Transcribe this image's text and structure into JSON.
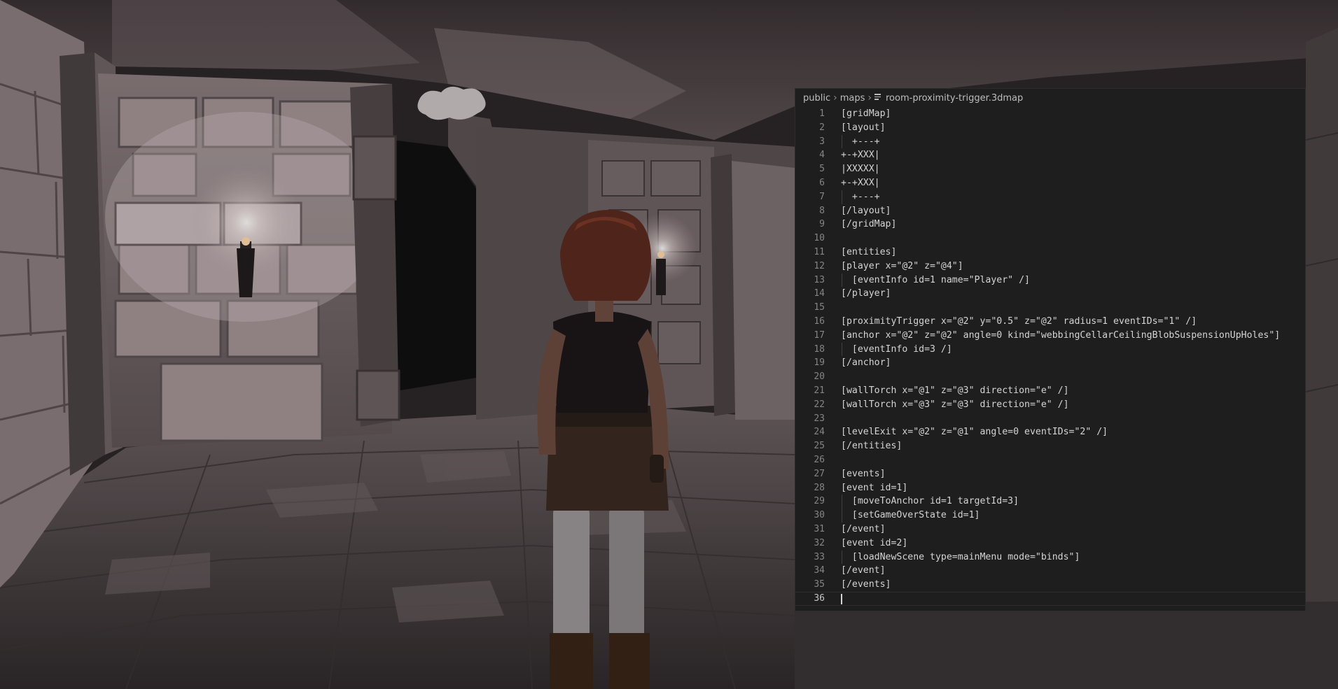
{
  "scene": {
    "description_icons": [
      "wall-torch-icon",
      "player-character"
    ],
    "colors": {
      "torch_glow": "#fff6ee",
      "stone": "#7c6e70",
      "floor": "#4a4244"
    }
  },
  "editor": {
    "breadcrumb": {
      "parts": [
        "public",
        "maps"
      ],
      "file_icon": "file-lines-icon",
      "file_name": "room-proximity-trigger.3dmap"
    },
    "current_line": 36,
    "lines": [
      "[gridMap]",
      "[layout]",
      "  +---+",
      "+-+XXX|",
      "|XXXXX|",
      "+-+XXX|",
      "  +---+",
      "[/layout]",
      "[/gridMap]",
      "",
      "[entities]",
      "[player x=\"@2\" z=\"@4\"]",
      "  [eventInfo id=1 name=\"Player\" /]",
      "[/player]",
      "",
      "[proximityTrigger x=\"@2\" y=\"0.5\" z=\"@2\" radius=1 eventIDs=\"1\" /]",
      "[anchor x=\"@2\" z=\"@2\" angle=0 kind=\"webbingCellarCeilingBlobSuspensionUpHoles\"]",
      "  [eventInfo id=3 /]",
      "[/anchor]",
      "",
      "[wallTorch x=\"@1\" z=\"@3\" direction=\"e\" /]",
      "[wallTorch x=\"@3\" z=\"@3\" direction=\"e\" /]",
      "",
      "[levelExit x=\"@2\" z=\"@1\" angle=0 eventIDs=\"2\" /]",
      "[/entities]",
      "",
      "[events]",
      "[event id=1]",
      "  [moveToAnchor id=1 targetId=3]",
      "  [setGameOverState id=1]",
      "[/event]",
      "[event id=2]",
      "  [loadNewScene type=mainMenu mode=\"binds\"]",
      "[/event]",
      "[/events]",
      ""
    ]
  }
}
